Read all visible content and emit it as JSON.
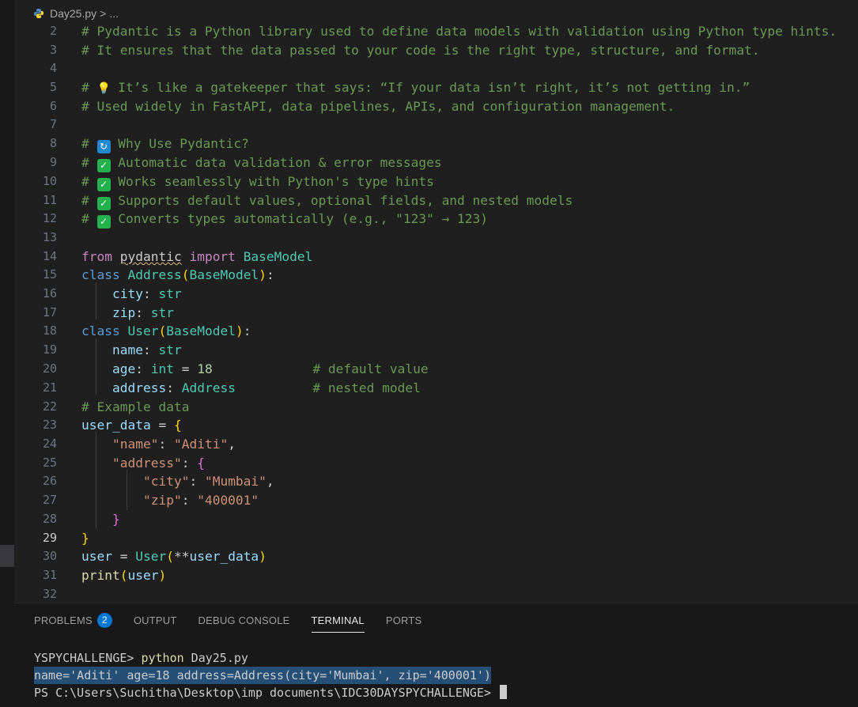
{
  "breadcrumb": {
    "file": "Day25.py",
    "sep": ">",
    "more": "..."
  },
  "editor": {
    "active_line": "29",
    "lines": [
      "2",
      "3",
      "4",
      "5",
      "6",
      "7",
      "8",
      "9",
      "10",
      "11",
      "12",
      "13",
      "14",
      "15",
      "16",
      "17",
      "18",
      "19",
      "20",
      "21",
      "22",
      "23",
      "24",
      "25",
      "26",
      "27",
      "28",
      "29",
      "30",
      "31",
      "32"
    ],
    "text": {
      "l2": "# Pydantic is a Python library used to define data models with validation using Python type hints.",
      "l3": "# It ensures that the data passed to your code is the right type, structure, and format.",
      "l5a": "# ",
      "l5b": " It’s like a gatekeeper that says: “If your data isn’t right, it’s not getting in.”",
      "l6": "# Used widely in FastAPI, data pipelines, APIs, and configuration management.",
      "l8a": "# ",
      "l8b": " Why Use Pydantic?",
      "l9a": "# ",
      "l9b": " Automatic data validation & error messages",
      "l10a": "# ",
      "l10b": " Works seamlessly with Python's type hints",
      "l11a": "# ",
      "l11b": " Supports default values, optional fields, and nested models",
      "l12a": "# ",
      "l12b": " Converts types automatically (e.g., \"123\" → 123)",
      "from": "from",
      "pydantic": "pydantic",
      "import": "import",
      "basemodel": "BaseModel",
      "class": "class",
      "address_cls": "Address",
      "user_cls": "User",
      "city": "city",
      "zip": "zip",
      "str": "str",
      "name": "name",
      "age": "age",
      "int": "int",
      "eighteen": "18",
      "address": "address",
      "cmt_default": "# default value",
      "cmt_nested": "# nested model",
      "cmt_example": "# Example data",
      "user_data": "user_data",
      "user": "user",
      "print": "print",
      "s_name": "\"name\"",
      "s_aditi": "\"Aditi\"",
      "s_address": "\"address\"",
      "s_city": "\"city\"",
      "s_mumbai": "\"Mumbai\"",
      "s_zip": "\"zip\"",
      "s_zipval": "\"400001\""
    }
  },
  "panel": {
    "tabs": [
      "PROBLEMS",
      "OUTPUT",
      "DEBUG CONSOLE",
      "TERMINAL",
      "PORTS"
    ],
    "problems_count": "2",
    "active_tab": "TERMINAL"
  },
  "terminal": {
    "line1_prompt": "YSPYCHALLENGE> ",
    "line1_cmd": "python",
    "line1_arg": " Day25.py",
    "line2": "name='Aditi' age=18 address=Address(city='Mumbai', zip='400001')",
    "line3": "PS C:\\Users\\Suchitha\\Desktop\\imp documents\\IDC30DAYSPYCHALLENGE> "
  },
  "icons": {
    "file": "python-icon",
    "bulb": "lightbulb-icon",
    "sync": "sync-icon",
    "check": "check-mark-icon"
  }
}
